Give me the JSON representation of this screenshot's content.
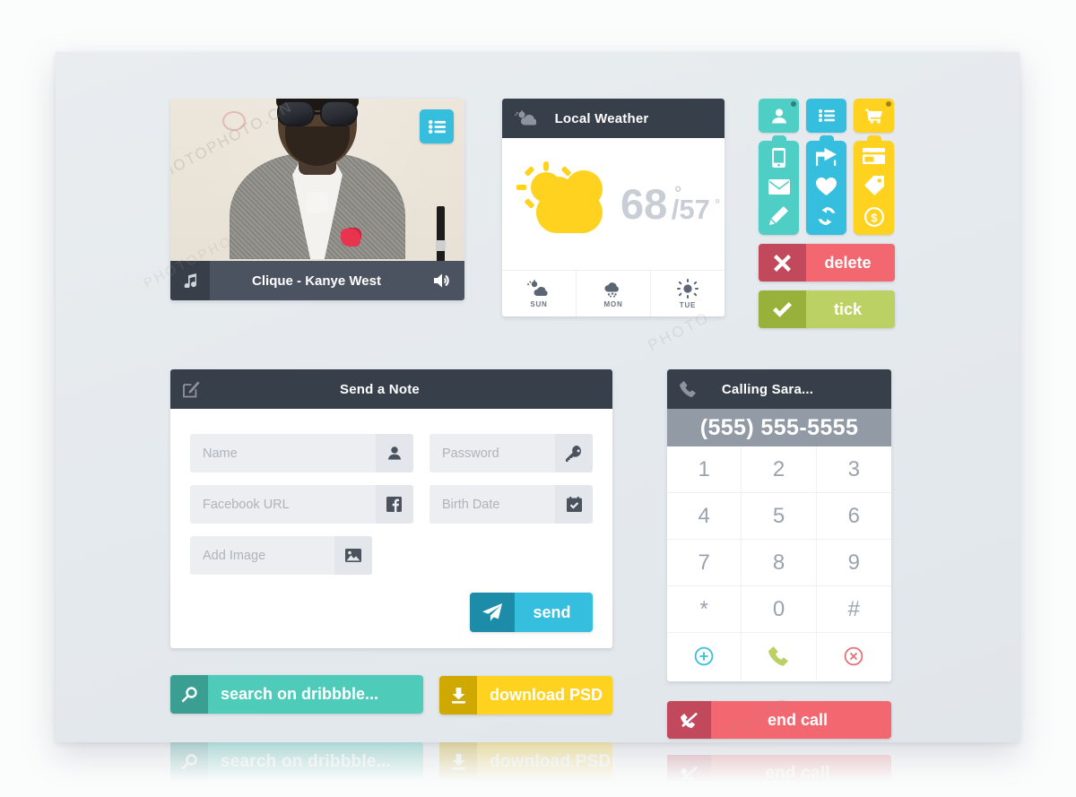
{
  "player": {
    "list_icon": "list-icon",
    "music_icon": "music-note-icon",
    "track_title": "Clique  - Kanye West",
    "volume_icon": "volume-icon",
    "watermark": "PHOTOPHOTO.CN"
  },
  "weather": {
    "header_icon": "sun-cloud-icon",
    "title": "Local Weather",
    "high": "68",
    "high_deg": "°",
    "low": "/57",
    "low_deg": "°",
    "forecast": [
      {
        "day": "SUN",
        "icon": "partly-cloudy-icon"
      },
      {
        "day": "MON",
        "icon": "snow-cloud-icon"
      },
      {
        "day": "TUE",
        "icon": "sun-icon"
      }
    ]
  },
  "icon_grid": {
    "colors": {
      "teal": "#4ecec4",
      "blue": "#35bede",
      "yellow": "#ffd21f"
    },
    "top_row": [
      {
        "name": "user-icon",
        "color": "teal",
        "badge": true
      },
      {
        "name": "list-icon",
        "color": "blue",
        "badge": false
      },
      {
        "name": "shopping-cart-icon",
        "color": "yellow",
        "badge": true
      }
    ],
    "columns": [
      {
        "color": "teal",
        "icons": [
          "mobile-phone-icon",
          "envelope-icon",
          "pencil-icon"
        ]
      },
      {
        "color": "blue",
        "icons": [
          "share-icon",
          "heart-icon",
          "refresh-icon"
        ]
      },
      {
        "color": "yellow",
        "icons": [
          "credit-card-icon",
          "price-tag-icon",
          "dollar-icon"
        ]
      }
    ],
    "buttons": [
      {
        "name": "delete-button",
        "label": "delete",
        "icon": "cross-icon",
        "color": "#f26770",
        "icon_color": "#c2485c"
      },
      {
        "name": "tick-button",
        "label": "tick",
        "icon": "check-icon",
        "color": "#bcd163",
        "icon_color": "#97b13a"
      }
    ]
  },
  "note_form": {
    "header_icon": "compose-icon",
    "title": "Send a Note",
    "fields": [
      {
        "name": "name-field",
        "placeholder": "Name",
        "icon": "user-icon"
      },
      {
        "name": "password-field",
        "placeholder": "Password",
        "icon": "key-icon"
      },
      {
        "name": "facebook-url-field",
        "placeholder": "Facebook URL",
        "icon": "facebook-icon"
      },
      {
        "name": "birth-date-field",
        "placeholder": "Birth Date",
        "icon": "calendar-check-icon"
      },
      {
        "name": "add-image-field",
        "placeholder": "Add Image",
        "icon": "image-icon"
      }
    ],
    "send_label": "send",
    "send_icon": "paper-plane-icon"
  },
  "promo_buttons": [
    {
      "name": "search-dribbble-button",
      "label": "search on dribbble...",
      "icon": "search-icon",
      "color": "#4ecbb9"
    },
    {
      "name": "download-psd-button",
      "label": "download PSD",
      "icon": "download-icon",
      "color": "#ffd21f"
    }
  ],
  "dialer": {
    "header_icon": "phone-icon",
    "title": "Calling Sara...",
    "number": "(555) 555-5555",
    "keys": [
      "1",
      "2",
      "3",
      "4",
      "5",
      "6",
      "7",
      "8",
      "9",
      "*",
      "0",
      "#"
    ],
    "action_keys": [
      {
        "name": "add-contact-key",
        "icon": "plus-circle-icon",
        "color": "#35bede"
      },
      {
        "name": "call-key",
        "icon": "phone-icon",
        "color": "#bcd163"
      },
      {
        "name": "cancel-key",
        "icon": "cancel-circle-icon",
        "color": "#e0707a"
      }
    ],
    "end_call_label": "end call",
    "end_call_icon": "phone-hangup-icon"
  },
  "reflection": {
    "dribbble_label": "search on dribbble...",
    "psd_label": "download PSD",
    "end_call_label": "end call"
  },
  "watermarks": {
    "a": "PHOTOPHOTO.CN",
    "b": "PHOTO",
    "c": "PHOTO"
  }
}
